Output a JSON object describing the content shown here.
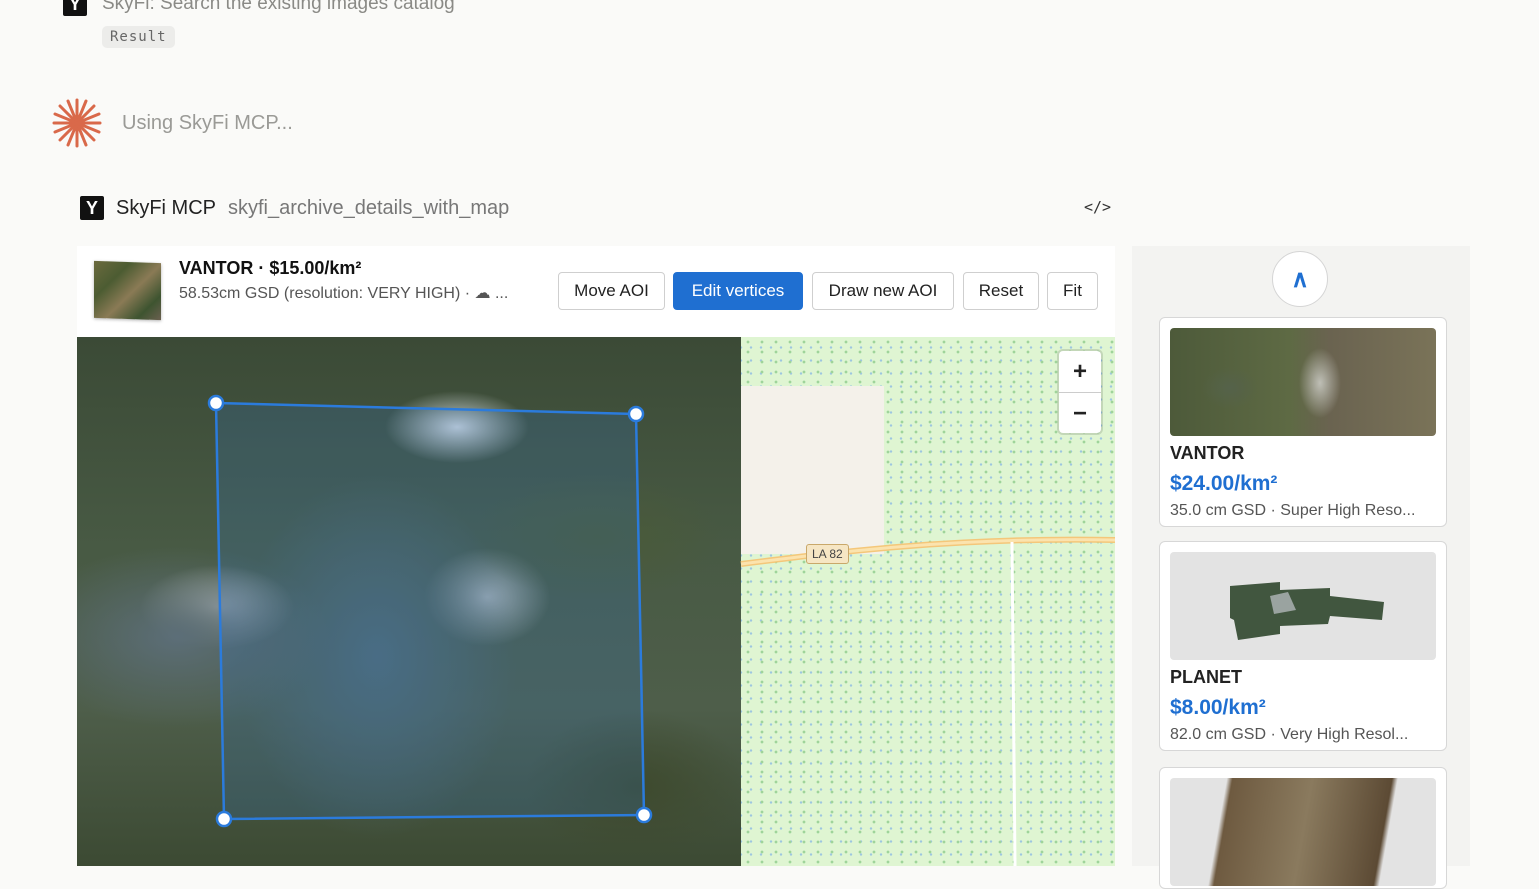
{
  "header": {
    "prev_tool_text": "SkyFi: Search the existing images catalog",
    "result_chip": "Result",
    "using_text": "Using SkyFi MCP...",
    "mcp_name": "SkyFi MCP",
    "tool_name": "skyfi_archive_details_with_map",
    "code_icon_glyph": "</>"
  },
  "detail": {
    "title": "VANTOR · $15.00/km²",
    "subtitle": "58.53cm GSD (resolution: VERY HIGH) · ☁ ...",
    "buttons": {
      "move_aoi": "Move AOI",
      "edit_vertices": "Edit vertices",
      "draw_new_aoi": "Draw new AOI",
      "reset": "Reset",
      "fit": "Fit"
    }
  },
  "map": {
    "zoom_in": "+",
    "zoom_out": "−",
    "road_label": "LA 82",
    "aoi_color": "#2b7bdc"
  },
  "rail": {
    "up_glyph": "∧",
    "cards": [
      {
        "provider": "VANTOR",
        "price": "$24.00/km²",
        "gsd": "35.0 cm GSD · Super High Reso..."
      },
      {
        "provider": "PLANET",
        "price": "$8.00/km²",
        "gsd": "82.0 cm GSD · Very High Resol..."
      }
    ]
  },
  "colors": {
    "accent": "#1f6fd1",
    "spark": "#d9694a"
  }
}
